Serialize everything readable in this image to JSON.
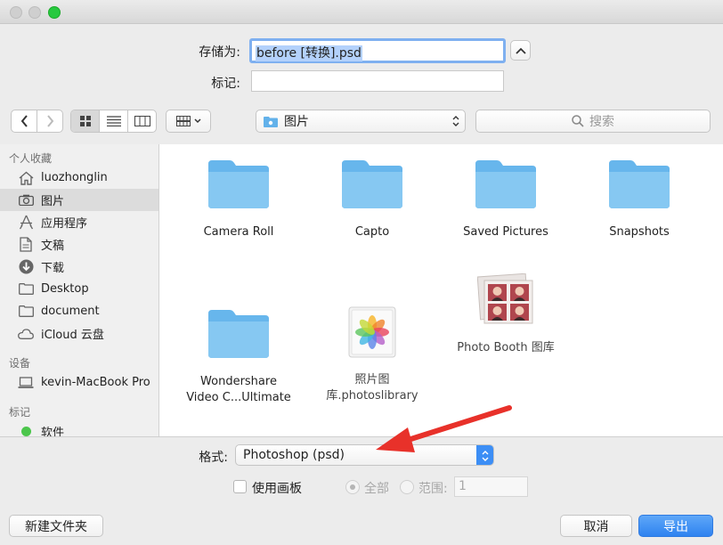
{
  "dialog": {
    "save_as_label": "存储为:",
    "filename": "before [转换].psd",
    "tags_label": "标记:",
    "tags_value": ""
  },
  "toolbar": {
    "location": "图片",
    "search_placeholder": "搜索"
  },
  "sidebar": {
    "favorites_header": "个人收藏",
    "favorites": [
      {
        "label": "luozhonglin",
        "icon": "home-icon"
      },
      {
        "label": "图片",
        "icon": "camera-icon",
        "selected": true
      },
      {
        "label": "应用程序",
        "icon": "apps-icon"
      },
      {
        "label": "文稿",
        "icon": "document-icon"
      },
      {
        "label": "下载",
        "icon": "download-icon"
      },
      {
        "label": "Desktop",
        "icon": "folder-icon"
      },
      {
        "label": "document",
        "icon": "folder-icon"
      },
      {
        "label": "iCloud 云盘",
        "icon": "cloud-icon"
      }
    ],
    "devices_header": "设备",
    "devices": [
      {
        "label": "kevin-MacBook Pro",
        "icon": "laptop-icon"
      }
    ],
    "tags_header": "标记",
    "tags": [
      {
        "label": "软件",
        "color": "#4cc64c"
      }
    ]
  },
  "files": [
    {
      "name": "Camera Roll",
      "type": "folder"
    },
    {
      "name": "Capto",
      "type": "folder"
    },
    {
      "name": "Saved Pictures",
      "type": "folder"
    },
    {
      "name": "Snapshots",
      "type": "folder"
    },
    {
      "name": "Wondershare\nVideo C...Ultimate",
      "type": "folder"
    },
    {
      "name": "照片图\n库.photoslibrary",
      "type": "photos-library"
    },
    {
      "name": "Photo Booth 图库",
      "type": "photo-booth-library"
    }
  ],
  "format": {
    "label": "格式:",
    "value": "Photoshop (psd)",
    "use_artboard_label": "使用画板",
    "all_label": "全部",
    "range_label": "范围:",
    "range_value": "1"
  },
  "footer": {
    "new_folder": "新建文件夹",
    "cancel": "取消",
    "export": "导出"
  },
  "colors": {
    "accent": "#3c8ef5",
    "arrow": "#e8312a",
    "folder": "#74c0ee"
  }
}
